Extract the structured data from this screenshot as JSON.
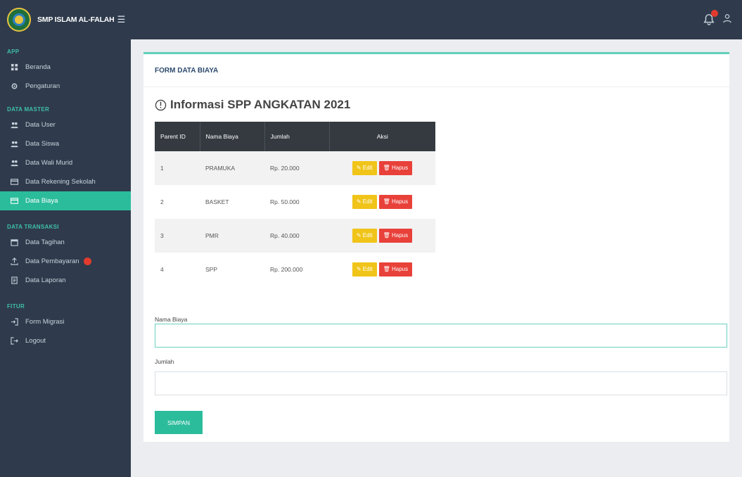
{
  "brand": {
    "name": "SMP ISLAM AL-FALAH"
  },
  "sidebar": {
    "sections": [
      {
        "title": "APP",
        "items": [
          {
            "label": "Beranda",
            "icon": "grid-icon"
          },
          {
            "label": "Pengaturan",
            "icon": "gear-icon"
          }
        ]
      },
      {
        "title": "DATA MASTER",
        "items": [
          {
            "label": "Data User",
            "icon": "users-icon"
          },
          {
            "label": "Data Siswa",
            "icon": "users-icon"
          },
          {
            "label": "Data Wali Murid",
            "icon": "users-icon"
          },
          {
            "label": "Data Rekening Sekolah",
            "icon": "card-icon"
          },
          {
            "label": "Data Biaya",
            "icon": "card-icon",
            "active": true
          }
        ]
      },
      {
        "title": "DATA TRANSAKSI",
        "items": [
          {
            "label": "Data Tagihan",
            "icon": "calendar-icon"
          },
          {
            "label": "Data Pembayaran",
            "icon": "upload-icon",
            "badge": true
          },
          {
            "label": "Data Laporan",
            "icon": "document-icon"
          }
        ]
      },
      {
        "title": "FITUR",
        "items": [
          {
            "label": "Form Migrasi",
            "icon": "sign-in-icon"
          },
          {
            "label": "Logout",
            "icon": "sign-out-icon"
          }
        ]
      }
    ]
  },
  "card": {
    "title": "FORM DATA BIAYA"
  },
  "info": {
    "title": "Informasi SPP ANGKATAN 2021"
  },
  "table": {
    "headers": [
      "Parent ID",
      "Nama Biaya",
      "Jumlah",
      "Aksi"
    ],
    "rows": [
      {
        "id": "1",
        "nama": "PRAMUKA",
        "jumlah": "Rp. 20.000"
      },
      {
        "id": "2",
        "nama": "BASKET",
        "jumlah": "Rp. 50.000"
      },
      {
        "id": "3",
        "nama": "PMR",
        "jumlah": "Rp. 40.000"
      },
      {
        "id": "4",
        "nama": "SPP",
        "jumlah": "Rp. 200.000"
      }
    ],
    "edit_label": "✎ Edit",
    "hapus_label": "🗑 Hapus"
  },
  "form": {
    "nama_label": "Nama Biaya",
    "nama_value": "",
    "jumlah_label": "Jumlah",
    "jumlah_value": "",
    "submit_label": "SIMPAN"
  },
  "colors": {
    "accent": "#2bbc9c",
    "dark": "#2f3b4c",
    "edit": "#f0c419",
    "delete": "#e8413a"
  }
}
